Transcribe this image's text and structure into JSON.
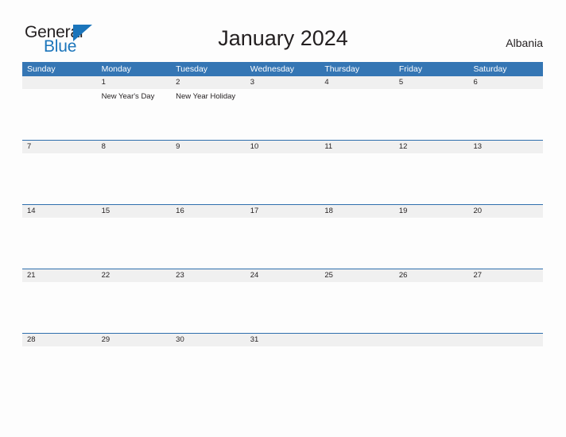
{
  "brand": {
    "name_part1": "General",
    "name_part2": "Blue",
    "triangle_color": "#1b75bb",
    "text_color": "#231f20"
  },
  "header": {
    "title": "January 2024",
    "country": "Albania"
  },
  "theme": {
    "header_bar_color": "#3576b4",
    "header_text_color": "#ffffff",
    "daynum_band_color": "#f0f0f0",
    "row_divider_color": "#2f6fad",
    "page_background": "#fdfdfd",
    "text_color": "#231f20"
  },
  "calendar": {
    "month": "January",
    "year": "2024",
    "weekday_headers": [
      "Sunday",
      "Monday",
      "Tuesday",
      "Wednesday",
      "Thursday",
      "Friday",
      "Saturday"
    ],
    "weeks": [
      {
        "days": [
          {
            "num": "",
            "events": []
          },
          {
            "num": "1",
            "events": [
              "New Year's Day"
            ]
          },
          {
            "num": "2",
            "events": [
              "New Year Holiday"
            ]
          },
          {
            "num": "3",
            "events": []
          },
          {
            "num": "4",
            "events": []
          },
          {
            "num": "5",
            "events": []
          },
          {
            "num": "6",
            "events": []
          }
        ]
      },
      {
        "days": [
          {
            "num": "7",
            "events": []
          },
          {
            "num": "8",
            "events": []
          },
          {
            "num": "9",
            "events": []
          },
          {
            "num": "10",
            "events": []
          },
          {
            "num": "11",
            "events": []
          },
          {
            "num": "12",
            "events": []
          },
          {
            "num": "13",
            "events": []
          }
        ]
      },
      {
        "days": [
          {
            "num": "14",
            "events": []
          },
          {
            "num": "15",
            "events": []
          },
          {
            "num": "16",
            "events": []
          },
          {
            "num": "17",
            "events": []
          },
          {
            "num": "18",
            "events": []
          },
          {
            "num": "19",
            "events": []
          },
          {
            "num": "20",
            "events": []
          }
        ]
      },
      {
        "days": [
          {
            "num": "21",
            "events": []
          },
          {
            "num": "22",
            "events": []
          },
          {
            "num": "23",
            "events": []
          },
          {
            "num": "24",
            "events": []
          },
          {
            "num": "25",
            "events": []
          },
          {
            "num": "26",
            "events": []
          },
          {
            "num": "27",
            "events": []
          }
        ]
      },
      {
        "days": [
          {
            "num": "28",
            "events": []
          },
          {
            "num": "29",
            "events": []
          },
          {
            "num": "30",
            "events": []
          },
          {
            "num": "31",
            "events": []
          },
          {
            "num": "",
            "events": []
          },
          {
            "num": "",
            "events": []
          },
          {
            "num": "",
            "events": []
          }
        ]
      }
    ]
  }
}
